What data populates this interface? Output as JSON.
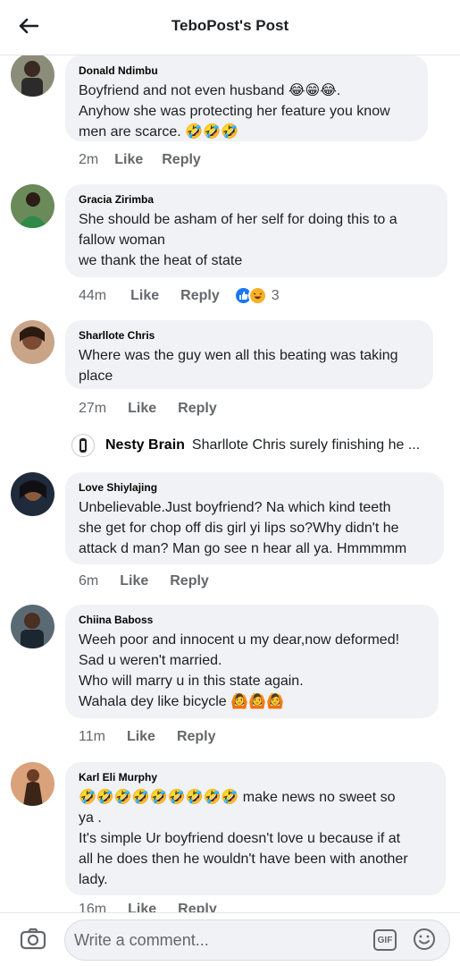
{
  "header": {
    "title": "TeboPost's Post"
  },
  "comments": [
    {
      "author": "Donald Ndimbu",
      "text": "Boyfriend and not even husband 😂😁😂.\nAnyhow she was protecting her feature you know\nmen are scarce. 🤣🤣🤣",
      "time": "2m",
      "like": "Like",
      "reply": "Reply"
    },
    {
      "author": "Gracia Zirimba",
      "text": "She should  be asham of her self  for doing this  to a\nfallow  woman\nwe thank the  heat of state",
      "time": "44m",
      "like": "Like",
      "reply": "Reply",
      "reaction_count": "3"
    },
    {
      "author": "Sharllote Chris",
      "text": "Where was the guy wen all this beating was taking\nplace",
      "time": "27m",
      "like": "Like",
      "reply": "Reply"
    },
    {
      "author": "Love Shiylajing",
      "text": "Unbelievable.Just boyfriend? Na which kind teeth\nshe get for chop off dis girl yi lips so?Why didn't he\nattack d man? Man go see n hear all ya. Hmmmmm",
      "time": "6m",
      "like": "Like",
      "reply": "Reply"
    },
    {
      "author": "Chiina Baboss",
      "text": "Weeh poor and innocent u my dear,now deformed!\nSad u weren't married.\nWho will marry u in this state again.\nWahala dey like bicycle 🙆🙆🙆",
      "time": "11m",
      "like": "Like",
      "reply": "Reply"
    },
    {
      "author": "Karl Eli Murphy",
      "text": "🤣🤣🤣🤣🤣🤣🤣🤣🤣 make news no sweet so\nya .\nIt's simple Ur boyfriend doesn't love u because if at\nall he does then he wouldn't have been with another\nlady.",
      "time": "16m",
      "like": "Like",
      "reply": "Reply"
    }
  ],
  "nested_reply": {
    "author": "Nesty Brain",
    "text": "Sharllote Chris surely finishing he ..."
  },
  "composer": {
    "placeholder": "Write a comment...",
    "gif_label": "GIF"
  },
  "colors": {
    "bubble": "#f0f2f5",
    "secondary_text": "#65676b",
    "like_blue": "#1877f2",
    "haha_yellow": "#f7b125"
  }
}
